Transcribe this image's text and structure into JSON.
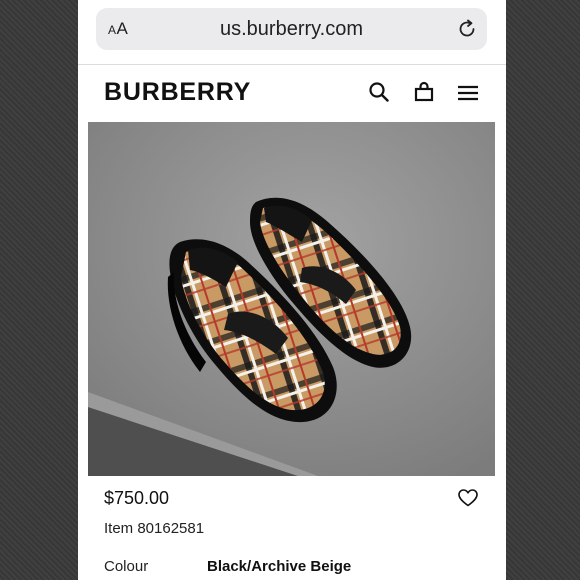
{
  "browser": {
    "text_size_label_small": "A",
    "text_size_label_large": "A",
    "url": "us.burberry.com",
    "icons": {
      "text_size": "text-size-icon",
      "reload": "reload-icon"
    }
  },
  "header": {
    "logo": "BURBERRY",
    "icons": {
      "search": "search-icon",
      "bag": "shopping-bag-icon",
      "menu": "menu-icon"
    }
  },
  "product": {
    "image": "product-image",
    "price": "$750.00",
    "item_number": "Item 80162581",
    "colour_label": "Colour",
    "colour_value": "Black/Archive Beige",
    "wishlist_icon": "heart-icon"
  }
}
